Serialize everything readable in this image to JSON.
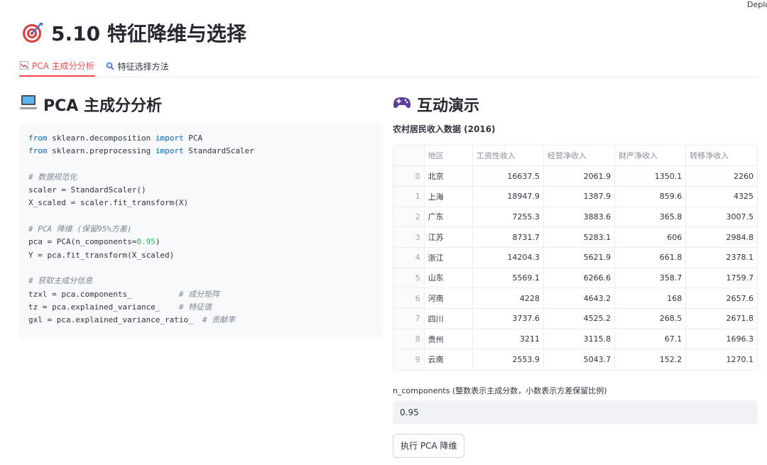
{
  "app": {
    "deploy_label": "Deploy"
  },
  "page": {
    "title": "5.10 特征降维与选择"
  },
  "tabs": [
    {
      "label": "PCA 主成分分析",
      "active": true
    },
    {
      "label": "特征选择方法",
      "active": false
    }
  ],
  "left": {
    "title": "PCA 主成分分析",
    "code": [
      [
        {
          "t": "from",
          "c": "kw"
        },
        {
          "t": " sklearn.decomposition "
        },
        {
          "t": "import",
          "c": "kw"
        },
        {
          "t": " PCA"
        }
      ],
      [
        {
          "t": "from",
          "c": "kw"
        },
        {
          "t": " sklearn.preprocessing "
        },
        {
          "t": "import",
          "c": "kw"
        },
        {
          "t": " StandardScaler"
        }
      ],
      [],
      [
        {
          "t": "# 数据规范化",
          "c": "cm"
        }
      ],
      [
        {
          "t": "scaler = StandardScaler()"
        }
      ],
      [
        {
          "t": "X_scaled = scaler.fit_transform(X)"
        }
      ],
      [],
      [
        {
          "t": "# PCA 降维 (保留95%方差)",
          "c": "cm"
        }
      ],
      [
        {
          "t": "pca = PCA(n_components="
        },
        {
          "t": "0.95",
          "c": "num"
        },
        {
          "t": ")"
        }
      ],
      [
        {
          "t": "Y = pca.fit_transform(X_scaled)"
        }
      ],
      [],
      [
        {
          "t": "# 获取主成分信息",
          "c": "cm"
        }
      ],
      [
        {
          "t": "tzxl = pca.components_          "
        },
        {
          "t": "# 成分矩阵",
          "c": "cm"
        }
      ],
      [
        {
          "t": "tz = pca.explained_variance_    "
        },
        {
          "t": "# 特征值",
          "c": "cm"
        }
      ],
      [
        {
          "t": "gxl = pca.explained_variance_ratio_  "
        },
        {
          "t": "# 贡献率",
          "c": "cm"
        }
      ]
    ]
  },
  "right": {
    "title": "互动演示",
    "data_title": "农村居民收入数据 (2016)",
    "table": {
      "columns": [
        "地区",
        "工资性收入",
        "经营净收入",
        "财产净收入",
        "转移净收入"
      ],
      "rows": [
        {
          "idx": "0",
          "cells": [
            "北京",
            "16637.5",
            "2061.9",
            "1350.1",
            "2260"
          ]
        },
        {
          "idx": "1",
          "cells": [
            "上海",
            "18947.9",
            "1387.9",
            "859.6",
            "4325"
          ]
        },
        {
          "idx": "2",
          "cells": [
            "广东",
            "7255.3",
            "3883.6",
            "365.8",
            "3007.5"
          ]
        },
        {
          "idx": "3",
          "cells": [
            "江苏",
            "8731.7",
            "5283.1",
            "606",
            "2984.8"
          ]
        },
        {
          "idx": "4",
          "cells": [
            "浙江",
            "14204.3",
            "5621.9",
            "661.8",
            "2378.1"
          ]
        },
        {
          "idx": "5",
          "cells": [
            "山东",
            "5569.1",
            "6266.6",
            "358.7",
            "1759.7"
          ]
        },
        {
          "idx": "6",
          "cells": [
            "河南",
            "4228",
            "4643.2",
            "168",
            "2657.6"
          ]
        },
        {
          "idx": "7",
          "cells": [
            "四川",
            "3737.6",
            "4525.2",
            "268.5",
            "2671.8"
          ]
        },
        {
          "idx": "8",
          "cells": [
            "贵州",
            "3211",
            "3115.8",
            "67.1",
            "1696.3"
          ]
        },
        {
          "idx": "9",
          "cells": [
            "云南",
            "2553.9",
            "5043.7",
            "152.2",
            "1270.1"
          ]
        }
      ]
    },
    "ncomp": {
      "label": "n_components (整数表示主成分数，小数表示方差保留比例)",
      "value": "0.95"
    },
    "run_button": "执行 PCA 降维"
  },
  "colors": {
    "accent": "#ff4b4b",
    "keyword": "#0068c9",
    "number": "#21c354",
    "comment": "#808495"
  },
  "icons": {
    "title": "target-icon",
    "tab_pca": "chart-icon",
    "tab_select": "magnifier-icon",
    "left_section": "laptop-icon",
    "right_section": "gamepad-icon"
  }
}
